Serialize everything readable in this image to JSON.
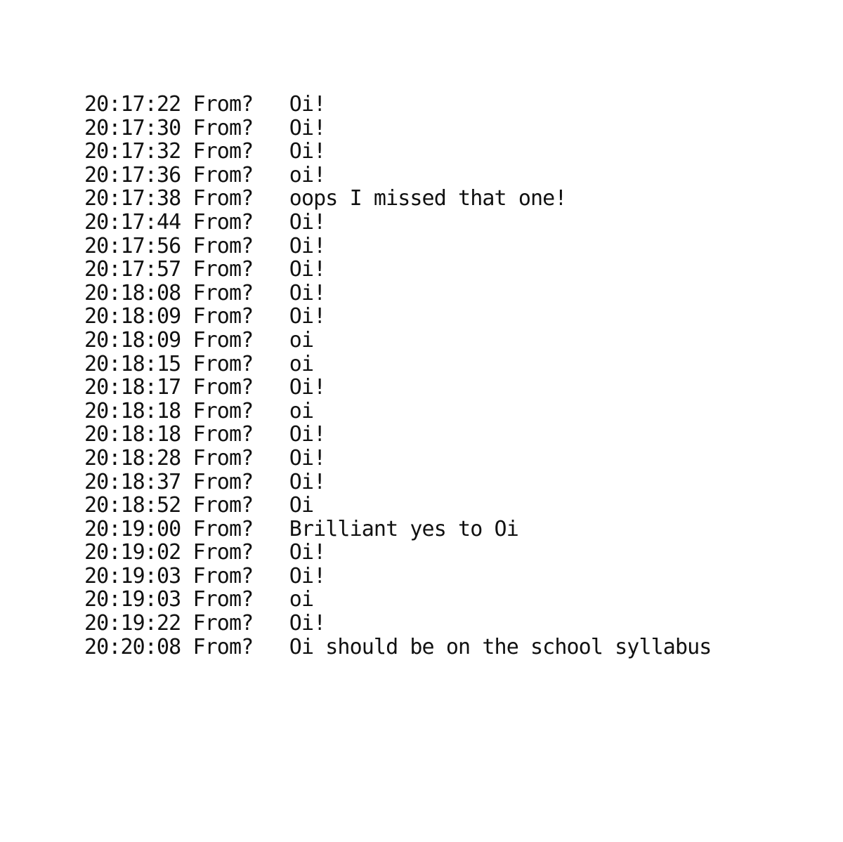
{
  "document": {
    "type": "chat-transcript",
    "background_color": "#ffffff",
    "text_color": "#111111",
    "sender_label": "From?",
    "column_separator_after_time": " ",
    "column_separator_after_sender": "   ",
    "line_count": 23
  },
  "lines": [
    {
      "time": "20:17:22",
      "sender": "From?",
      "message": "Oi!"
    },
    {
      "time": "20:17:30",
      "sender": "From?",
      "message": "Oi!"
    },
    {
      "time": "20:17:32",
      "sender": "From?",
      "message": "Oi!"
    },
    {
      "time": "20:17:36",
      "sender": "From?",
      "message": "oi!"
    },
    {
      "time": "20:17:38",
      "sender": "From?",
      "message": "oops I missed that one!"
    },
    {
      "time": "20:17:44",
      "sender": "From?",
      "message": "Oi!"
    },
    {
      "time": "20:17:56",
      "sender": "From?",
      "message": "Oi!"
    },
    {
      "time": "20:17:57",
      "sender": "From?",
      "message": "Oi!"
    },
    {
      "time": "20:18:08",
      "sender": "From?",
      "message": "Oi!"
    },
    {
      "time": "20:18:09",
      "sender": "From?",
      "message": "Oi!"
    },
    {
      "time": "20:18:09",
      "sender": "From?",
      "message": "oi"
    },
    {
      "time": "20:18:15",
      "sender": "From?",
      "message": "oi"
    },
    {
      "time": "20:18:17",
      "sender": "From?",
      "message": "Oi!"
    },
    {
      "time": "20:18:18",
      "sender": "From?",
      "message": "oi"
    },
    {
      "time": "20:18:18",
      "sender": "From?",
      "message": "Oi!"
    },
    {
      "time": "20:18:28",
      "sender": "From?",
      "message": "Oi!"
    },
    {
      "time": "20:18:37",
      "sender": "From?",
      "message": "Oi!"
    },
    {
      "time": "20:18:52",
      "sender": "From?",
      "message": "Oi"
    },
    {
      "time": "20:19:00",
      "sender": "From?",
      "message": "Brilliant yes to Oi"
    },
    {
      "time": "20:19:02",
      "sender": "From?",
      "message": "Oi!"
    },
    {
      "time": "20:19:03",
      "sender": "From?",
      "message": "Oi!"
    },
    {
      "time": "20:19:03",
      "sender": "From?",
      "message": "oi"
    },
    {
      "time": "20:19:22",
      "sender": "From?",
      "message": "Oi!"
    },
    {
      "time": "20:20:08",
      "sender": "From?",
      "message": "Oi should be on the school syllabus"
    }
  ]
}
